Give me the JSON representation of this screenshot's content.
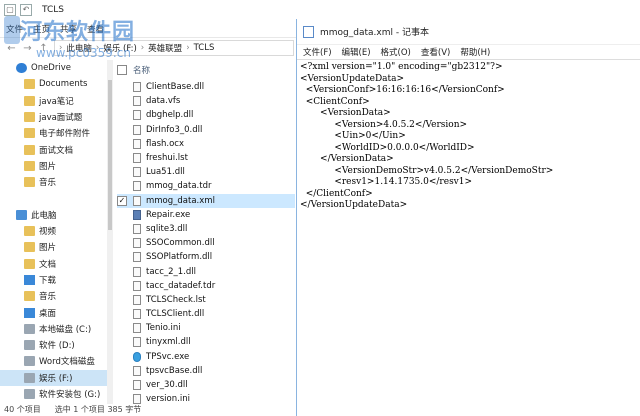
{
  "explorer": {
    "title": "TCLS",
    "ribbon": [
      "文件",
      "主页",
      "共享",
      "查看"
    ],
    "address": [
      "此电脑",
      "娱乐 (F:)",
      "英雄联盟",
      "TCLS"
    ],
    "nav_items": [
      {
        "label": "OneDrive",
        "icon": "cloud"
      },
      {
        "label": "Documents",
        "icon": "folder"
      },
      {
        "label": "java笔记",
        "icon": "folder"
      },
      {
        "label": "java面试题",
        "icon": "folder"
      },
      {
        "label": "电子邮件附件",
        "icon": "folder"
      },
      {
        "label": "面试文档",
        "icon": "folder"
      },
      {
        "label": "图片",
        "icon": "folder"
      },
      {
        "label": "音乐",
        "icon": "folder"
      },
      {
        "label": "",
        "icon": ""
      },
      {
        "label": "此电脑",
        "icon": "pc"
      },
      {
        "label": "视频",
        "icon": "folder"
      },
      {
        "label": "图片",
        "icon": "folder"
      },
      {
        "label": "文档",
        "icon": "folder"
      },
      {
        "label": "下载",
        "icon": "blue"
      },
      {
        "label": "音乐",
        "icon": "folder"
      },
      {
        "label": "桌面",
        "icon": "blue"
      },
      {
        "label": "本地磁盘 (C:)",
        "icon": "drive"
      },
      {
        "label": "软件 (D:)",
        "icon": "drive"
      },
      {
        "label": "Word文档磁盘",
        "icon": "drive"
      },
      {
        "label": "娱乐 (F:)",
        "icon": "drive"
      },
      {
        "label": "软件安装包 (G:)",
        "icon": "drive"
      }
    ],
    "column_name": "名称",
    "files": [
      {
        "name": "ClientBase.dll",
        "type": "file"
      },
      {
        "name": "data.vfs",
        "type": "file"
      },
      {
        "name": "dbghelp.dll",
        "type": "file"
      },
      {
        "name": "DirInfo3_0.dll",
        "type": "file"
      },
      {
        "name": "flash.ocx",
        "type": "file"
      },
      {
        "name": "freshui.lst",
        "type": "file"
      },
      {
        "name": "Lua51.dll",
        "type": "file"
      },
      {
        "name": "mmog_data.tdr",
        "type": "file"
      },
      {
        "name": "mmog_data.xml",
        "type": "file",
        "selected": true
      },
      {
        "name": "Repair.exe",
        "type": "exe"
      },
      {
        "name": "sqlite3.dll",
        "type": "file"
      },
      {
        "name": "SSOCommon.dll",
        "type": "file"
      },
      {
        "name": "SSOPlatform.dll",
        "type": "file"
      },
      {
        "name": "tacc_2_1.dll",
        "type": "file"
      },
      {
        "name": "tacc_datadef.tdr",
        "type": "file"
      },
      {
        "name": "TCLSCheck.lst",
        "type": "file"
      },
      {
        "name": "TCLSClient.dll",
        "type": "file"
      },
      {
        "name": "Tenio.ini",
        "type": "file"
      },
      {
        "name": "tinyxml.dll",
        "type": "file"
      },
      {
        "name": "TPSvc.exe",
        "type": "tp"
      },
      {
        "name": "tpsvcBase.dll",
        "type": "file"
      },
      {
        "name": "ver_30.dll",
        "type": "file"
      },
      {
        "name": "version.ini",
        "type": "file"
      }
    ],
    "status": [
      "40 个项目",
      "选中 1 个项目  385 字节"
    ]
  },
  "notepad": {
    "title": "mmog_data.xml - 记事本",
    "menu": [
      "文件(F)",
      "编辑(E)",
      "格式(O)",
      "查看(V)",
      "帮助(H)"
    ],
    "content": "<?xml version=\"1.0\" encoding=\"gb2312\"?>\n<VersionUpdateData>\n  <VersionConf>16:16:16:16</VersionConf>\n  <ClientConf>\n       <VersionData>\n            <Version>4.0.5.2</Version>\n            <Uin>0</Uin>\n            <WorldID>0.0.0.0</WorldID>\n       </VersionData>\n            <VersionDemoStr>v4.0.5.2</VersionDemoStr>\n            <resv1>1.14.1735.0</resv1>\n  </ClientConf>\n</VersionUpdateData>"
  },
  "watermark": {
    "line1": "河东软件园",
    "line2": "www.pc0359.cn"
  }
}
